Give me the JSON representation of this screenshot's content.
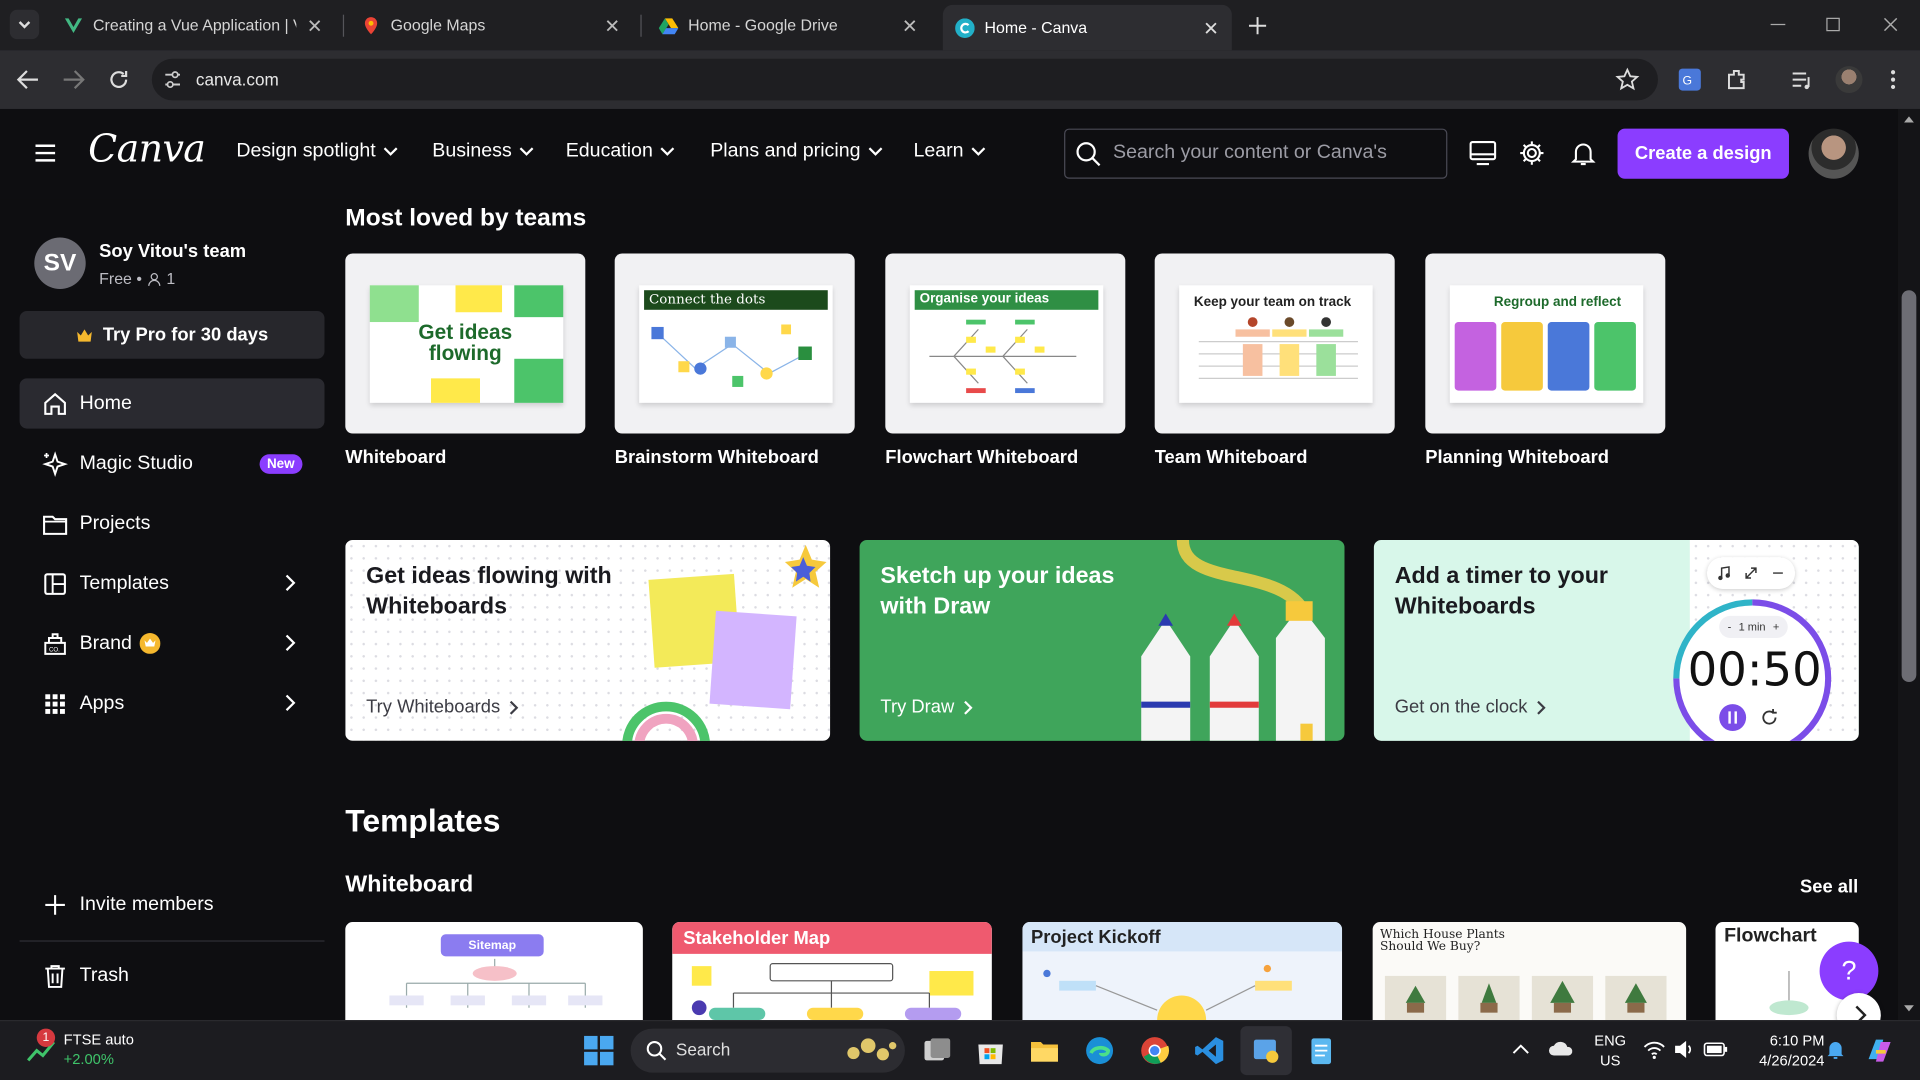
{
  "browser": {
    "tabs": [
      {
        "title": "Creating a Vue Application | Vue.js"
      },
      {
        "title": "Google Maps"
      },
      {
        "title": "Home - Google Drive"
      },
      {
        "title": "Home - Canva"
      }
    ],
    "url": "canva.com"
  },
  "header": {
    "logo": "Canva",
    "nav": [
      "Design spotlight",
      "Business",
      "Education",
      "Plans and pricing",
      "Learn"
    ],
    "search_placeholder": "Search your content or Canva's",
    "create_label": "Create a design"
  },
  "sidebar": {
    "avatar_initials": "SV",
    "team_name": "Soy Vitou's team",
    "plan": "Free •",
    "members": "1",
    "try_pro": "Try Pro for 30 days",
    "items": [
      {
        "label": "Home",
        "icon": "home-icon"
      },
      {
        "label": "Magic Studio",
        "icon": "sparkle-icon",
        "badge": "New"
      },
      {
        "label": "Projects",
        "icon": "folder-icon"
      },
      {
        "label": "Templates",
        "icon": "layout-icon"
      },
      {
        "label": "Brand",
        "icon": "brand-icon"
      },
      {
        "label": "Apps",
        "icon": "apps-icon"
      }
    ],
    "invite": "Invite members",
    "trash": "Trash"
  },
  "main": {
    "loved_title": "Most loved by teams",
    "loved": [
      {
        "label": "Whiteboard",
        "thumb_text": "Get ideas flowing"
      },
      {
        "label": "Brainstorm Whiteboard",
        "thumb_text": "Connect the dots"
      },
      {
        "label": "Flowchart Whiteboard",
        "thumb_text": "Organise your ideas"
      },
      {
        "label": "Team Whiteboard",
        "thumb_text": "Keep your team on track"
      },
      {
        "label": "Planning Whiteboard",
        "thumb_text": "Regroup and reflect"
      }
    ],
    "promos": [
      {
        "title": "Get ideas flowing with Whiteboards",
        "link": "Try Whiteboards"
      },
      {
        "title": "Sketch up your ideas with Draw",
        "link": "Try Draw"
      },
      {
        "title": "Add a timer to your Whiteboards",
        "link": "Get on the clock",
        "timer": "00:50",
        "timer_unit": "1 min"
      }
    ],
    "templates_title": "Templates",
    "whiteboard_title": "Whiteboard",
    "see_all": "See all",
    "templates": [
      {
        "title": "Sitemap"
      },
      {
        "title": "Stakeholder Map"
      },
      {
        "title": "Project Kickoff"
      },
      {
        "title": "Which House Plants Should We Buy?"
      },
      {
        "title": "Flowchart"
      }
    ]
  },
  "taskbar": {
    "widget_title": "FTSE auto",
    "widget_value": "+2.00%",
    "widget_badge": "1",
    "search": "Search",
    "lang1": "ENG",
    "lang2": "US",
    "time": "6:10 PM",
    "date": "4/26/2024"
  },
  "colors": {
    "accent": "#8b3dff",
    "green_promo": "#3fa55b",
    "mint_promo": "#d8f7ea"
  }
}
